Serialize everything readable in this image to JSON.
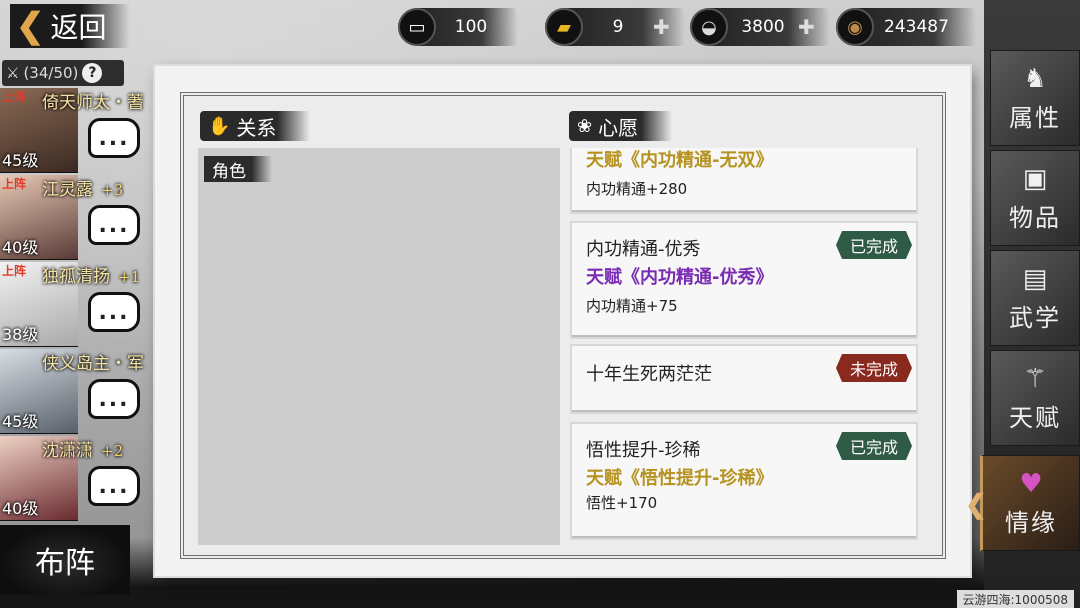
{
  "header": {
    "back_label": "返回",
    "resources": [
      {
        "icon": "scroll-icon",
        "value": "100"
      },
      {
        "icon": "gold-bar-icon",
        "value": "9"
      },
      {
        "icon": "silver-ingot-icon",
        "value": "3800"
      },
      {
        "icon": "copper-coin-icon",
        "value": "243487"
      }
    ]
  },
  "roster": {
    "count": "(34/50)",
    "help": "?",
    "heroes": [
      {
        "status": "上阵",
        "name": "倚天师太・蓍",
        "plus": "",
        "level": "45级",
        "chat": "..."
      },
      {
        "status": "上阵",
        "name": "江灵露",
        "plus": "+3",
        "level": "40级",
        "chat": "..."
      },
      {
        "status": "上阵",
        "name": "独孤清扬",
        "plus": "+1",
        "level": "38级",
        "chat": "..."
      },
      {
        "status": "",
        "name": "侠义岛主・军",
        "plus": "",
        "level": "45级",
        "chat": "..."
      },
      {
        "status": "",
        "name": "沈潇潇",
        "plus": "+2",
        "level": "40级",
        "chat": "..."
      }
    ],
    "formation_label": "布阵"
  },
  "relations": {
    "title": "关系",
    "tag": "角色"
  },
  "wishes": {
    "title": "心愿",
    "cards": [
      {
        "title": "",
        "talent": "天赋《内功精通-无双》",
        "effect": "内功精通+280",
        "badge": "",
        "talent_color": "#b6921f"
      },
      {
        "title": "内功精通-优秀",
        "talent": "天赋《内功精通-优秀》",
        "effect": "内功精通+75",
        "badge": "已完成",
        "talent_color": "#7a2bb3"
      },
      {
        "title": "十年生死两茫茫",
        "talent": "",
        "effect": "",
        "badge": "未完成",
        "talent_color": "#b6921f"
      },
      {
        "title": "悟性提升-珍稀",
        "talent": "天赋《悟性提升-珍稀》",
        "effect": "悟性+170",
        "badge": "已完成",
        "talent_color": "#b6921f"
      }
    ],
    "badge_colors": {
      "done": "#2f5a45",
      "undone": "#8a2a1e"
    }
  },
  "side_nav": [
    {
      "label": "属性",
      "icon": "horse-icon"
    },
    {
      "label": "物品",
      "icon": "gift-box-icon"
    },
    {
      "label": "武学",
      "icon": "book-icon"
    },
    {
      "label": "天赋",
      "icon": "talent-icon"
    },
    {
      "label": "情缘",
      "icon": "heart-icon"
    }
  ],
  "server_label": "云游四海:1000508"
}
